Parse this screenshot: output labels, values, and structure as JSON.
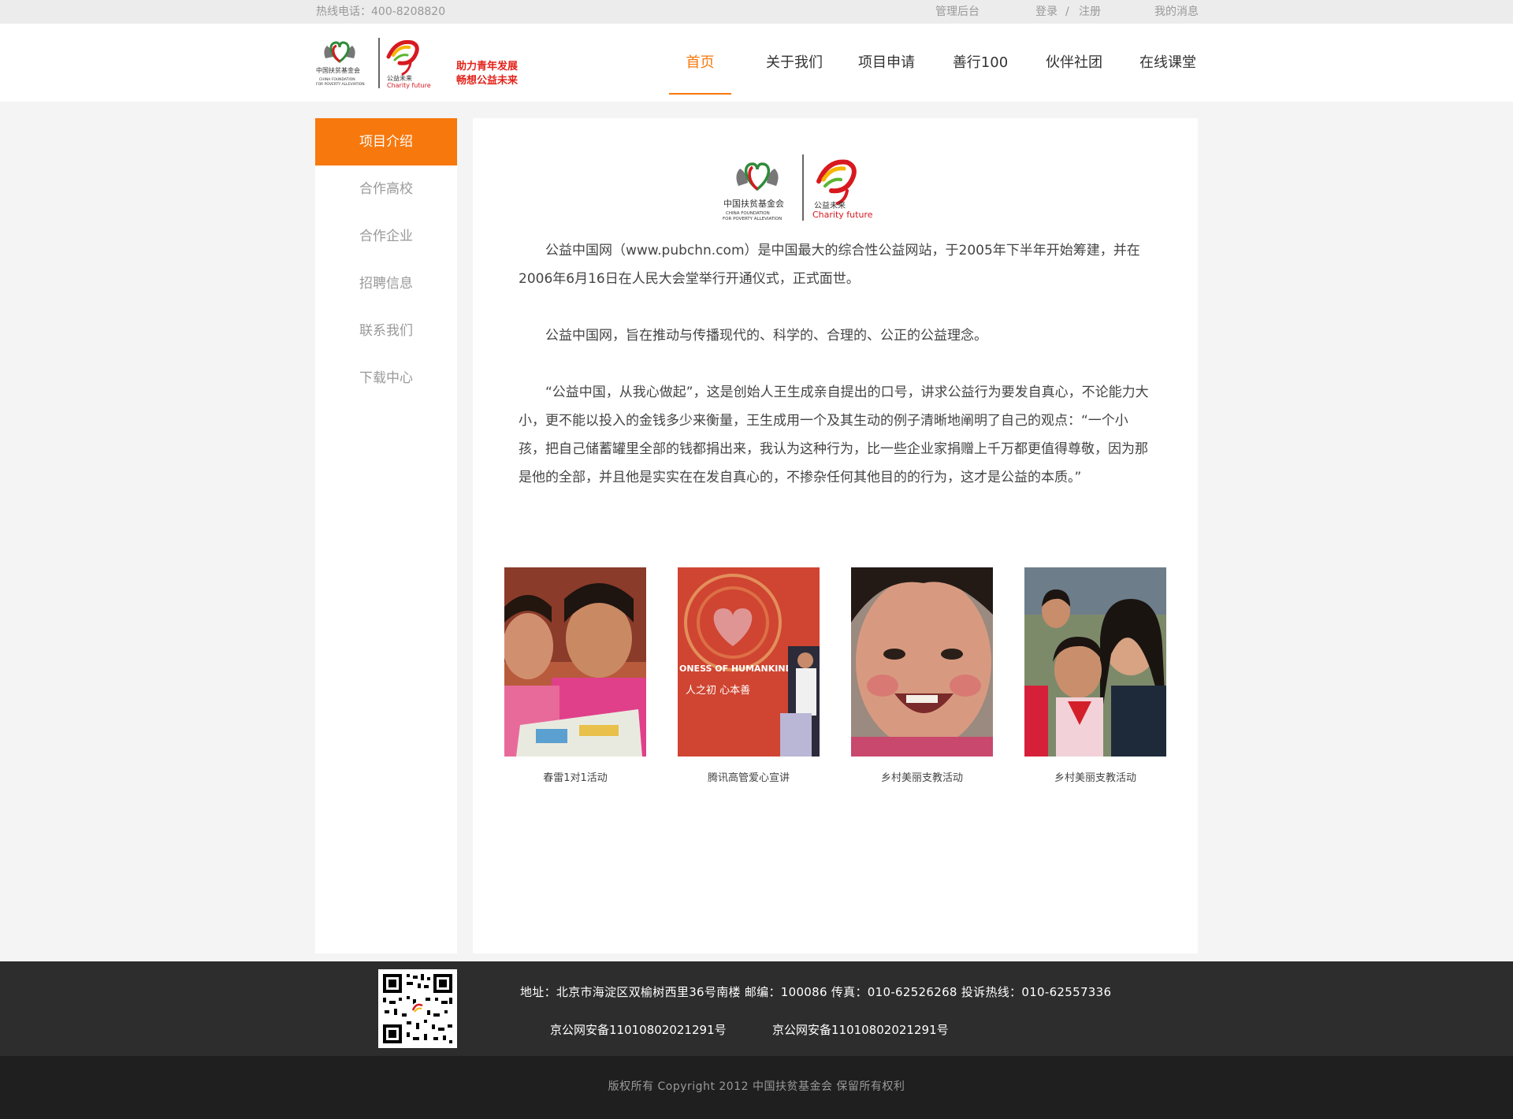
{
  "topbar": {
    "hotline": "热线电话：400-8208820",
    "admin": "管理后台",
    "login": "登录",
    "slash": "/",
    "register": "注册",
    "messages": "我的消息"
  },
  "header": {
    "logo_slogan_1": "助力青年发展",
    "logo_slogan_2": "畅想公益未来",
    "logo_org_cn": "中国扶贫基金会",
    "logo_org_en_1": "CHINA FOUNDATION",
    "logo_org_en_2": "FOR POVERTY ALLEVIATION",
    "logo_brand_cn": "公益未来",
    "logo_brand_en": "Charity future"
  },
  "nav": [
    {
      "label": "首页",
      "active": true
    },
    {
      "label": "关于我们"
    },
    {
      "label": "项目申请"
    },
    {
      "label": "善行100"
    },
    {
      "label": "伙伴社团"
    },
    {
      "label": "在线课堂"
    }
  ],
  "sidebar": [
    {
      "label": "项目介绍",
      "active": true
    },
    {
      "label": "合作高校"
    },
    {
      "label": "合作企业"
    },
    {
      "label": "招聘信息"
    },
    {
      "label": "联系我们"
    },
    {
      "label": "下载中心"
    }
  ],
  "content": {
    "p1": "公益中国网（www.pubchn.com）是中国最大的综合性公益网站，于2005年下半年开始筹建，并在2006年6月16日在人民大会堂举行开通仪式，正式面世。",
    "p2": "公益中国网，旨在推动与传播现代的、科学的、合理的、公正的公益理念。",
    "p3": "“公益中国，从我心做起”，这是创始人王生成亲自提出的口号，讲求公益行为要发自真心，不论能力大小，更不能以投入的金钱多少来衡量，王生成用一个及其生动的例子清晰地阐明了自己的观点：“一个小孩，把自己储蓄罐里全部的钱都捐出来，我认为这种行为，比一些企业家捐赠上千万都更值得尊敬，因为那是他的全部，并且他是实实在在发自真心的，不掺杂任何其他目的的行为，这才是公益的本质。”"
  },
  "photos": [
    {
      "caption": "春雷1对1活动",
      "icon": "photo-girls-reading"
    },
    {
      "caption": "腾讯高管爱心宣讲",
      "icon": "photo-stage-heart",
      "sign_text_1": "ONESS OF HUMANKIND",
      "sign_text_2": "人之初 心本善"
    },
    {
      "caption": "乡村美丽支教活动",
      "icon": "photo-smiling-child"
    },
    {
      "caption": "乡村美丽支教活动",
      "icon": "photo-teacher-children"
    }
  ],
  "footer": {
    "address": "地址：北京市海淀区双榆树西里36号南楼 邮编：100086 传真：010-62526268 投诉热线：010-62557336",
    "icp_1": "京公网安备11010802021291号",
    "icp_2": "京公网安备11010802021291号",
    "copyright": "版权所有 Copyright 2012 中国扶贫基金会 保留所有权利"
  },
  "colors": {
    "accent": "#f7780c",
    "footer_bg": "#2d2d2d",
    "copyright_bg": "#1f1f1f",
    "page_bg": "#f4f4f4"
  }
}
